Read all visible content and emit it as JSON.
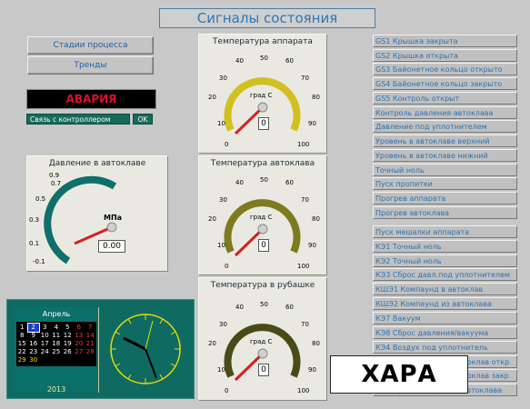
{
  "title": "Сигналы состояния",
  "left_buttons": [
    "Стадии процесса",
    "Тренды"
  ],
  "alarm": "АВАРИЯ",
  "connection_label": "Связь с контроллером",
  "connection_status": "OK",
  "gauges": {
    "pressure": {
      "title": "Давление в автоклаве",
      "unit": "МПа",
      "value": "0.00",
      "ticks": [
        "-0.1",
        "0.1",
        "0.3",
        "0.5",
        "0.7",
        "0.9"
      ]
    },
    "apparatus": {
      "title": "Температура аппарата",
      "unit": "град С",
      "value": "0",
      "ticks": [
        "0",
        "10",
        "20",
        "30",
        "40",
        "50",
        "60",
        "70",
        "80",
        "90",
        "100"
      ]
    },
    "autoclave": {
      "title": "Температура автоклава",
      "unit": "град С",
      "value": "0",
      "ticks": [
        "0",
        "10",
        "20",
        "30",
        "40",
        "50",
        "60",
        "70",
        "80",
        "90",
        "100"
      ]
    },
    "jacket": {
      "title": "Температура в рубашке",
      "unit": "град С",
      "value": "0",
      "ticks": [
        "0",
        "10",
        "20",
        "30",
        "40",
        "50",
        "60",
        "70",
        "80",
        "90",
        "100"
      ]
    }
  },
  "colors": {
    "gauge1": "#d0c020",
    "gauge2": "#7e7a20",
    "gauge3": "#4a4a18",
    "pressure": "#0f6f6c",
    "needle": "#d42020",
    "link": "#2b71b3"
  },
  "right_signals": [
    "GS1 Крышка закрыта",
    "GS2 Крышка открыта",
    "GS3 Байонетное кольцо открыто",
    "GS4 Байонетное кольцо закрыто",
    "GS5 Контроль открыт",
    "Контроль давления автоклава",
    "Давление под уплотнителем",
    "Уровень в автоклаве верхний",
    "Уровень в автоклаве нижний",
    "Точный ноль",
    "Пуск пропитки",
    "Прогрев аппарата",
    "Прогрев автоклава",
    "Пуск мешалки аппарата",
    "КЭ1 Точный ноль",
    "КЭ2 Точный ноль",
    "КЭ3 Сброс давл.под уплотнителем",
    "КШЭ1 Компаунд в автоклав",
    "КШЭ2 Компаунд из автоклава",
    "КЭ7 Вакуум",
    "КЭ8 Сброс давления/вакуума",
    "КЭ4 Воздух под уплотнитель",
    "КЭ5 Воздух (Азот) в автоклав откр",
    "КЭ6 Воздух (Азот) в автоклав закр",
    "Блокировка открытия автоклава"
  ],
  "calendar": {
    "month": "Апрель",
    "year": "2013",
    "rows": [
      [
        "1",
        "2",
        "3",
        "4",
        "5",
        "6",
        "7"
      ],
      [
        "8",
        "9",
        "10",
        "11",
        "12",
        "13",
        "14"
      ],
      [
        "15",
        "16",
        "17",
        "18",
        "19",
        "20",
        "21"
      ],
      [
        "22",
        "23",
        "24",
        "25",
        "26",
        "27",
        "28"
      ],
      [
        "29",
        "30",
        "",
        "",
        "",
        "",
        ""
      ]
    ],
    "today": "2"
  },
  "watermark": "ХАРА"
}
